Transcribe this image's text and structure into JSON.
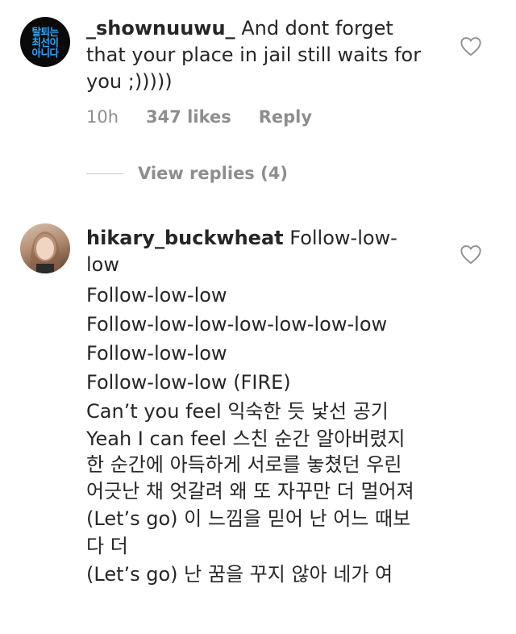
{
  "comments": [
    {
      "avatar_text": "탈퇴는\n최선이\n아니다",
      "username": "_shownuuwu_",
      "text": "And dont forget that your place in jail still waits for you ;)))))",
      "time": "10h",
      "likes": "347 likes",
      "reply": "Reply",
      "view_replies": "View replies (4)"
    },
    {
      "username": "hikary_buckwheat",
      "first_line": "Follow-low-low",
      "lines": [
        "Follow-low-low",
        "Follow-low-low-low-low-low-low",
        "Follow-low-low",
        "Follow-low-low (FIRE)",
        "Can’t you feel 익숙한 듯 낯선 공기",
        "Yeah I can feel 스친 순간 알아버렸지",
        "한 순간에 아득하게 서로를 놓쳤던 우린",
        "어긋난 채 엇갈려 왜 또 자꾸만 더 멀어져 (Let’s go) 이 느낌을 믿어 난 어느 때보다 더",
        "(Let’s go) 난 꿈을 꾸지 않아 네가 여"
      ]
    }
  ],
  "icons": {
    "like": "heart-outline-icon"
  }
}
